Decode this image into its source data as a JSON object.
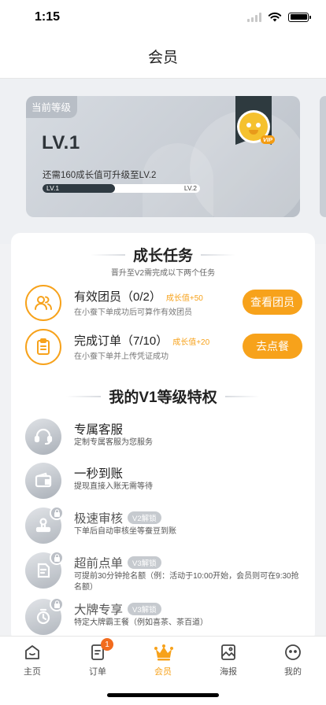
{
  "status_bar": {
    "time": "1:15"
  },
  "header": {
    "title": "会员"
  },
  "level_card": {
    "tag": "当前等级",
    "level": "LV.1",
    "need_text": "还需160成长值可升级至LV.2",
    "progress_fraction": 0.46,
    "bar_left_label": "LV.1",
    "bar_right_label": "LV.2",
    "badge_text": "VIP"
  },
  "growth_tasks": {
    "title": "成长任务",
    "subtitle": "晋升至V2需完成以下两个任务",
    "items": [
      {
        "icon": "team-member-icon",
        "name": "有效团员（0/2）",
        "reward": "成长值+50",
        "desc": "在小蚕下单成功后可算作有效团员",
        "button": "查看团员"
      },
      {
        "icon": "order-clipboard-icon",
        "name": "完成订单（7/10）",
        "reward": "成长值+20",
        "desc": "在小蚕下单并上传凭证成功",
        "button": "去点餐"
      }
    ]
  },
  "privileges": {
    "title": "我的V1等级特权",
    "items": [
      {
        "icon": "headset-service-icon",
        "name": "专属客服",
        "desc": "定制专属客服为您服务",
        "lock": ""
      },
      {
        "icon": "wallet-icon",
        "name": "一秒到账",
        "desc": "提现直接入账无需等待",
        "lock": ""
      },
      {
        "icon": "review-stamp-icon",
        "name": "极速审核",
        "desc": "下单后自动审核坐等蚕豆到账",
        "lock": "V2解锁"
      },
      {
        "icon": "early-order-icon",
        "name": "超前点单",
        "desc": "可提前30分钟抢名额（例：活动于10:00开始，会员则可在9:30抢名额）",
        "lock": "V3解锁"
      },
      {
        "icon": "brand-timer-icon",
        "name": "大牌专享",
        "desc": "特定大牌霸王餐（例如喜茶、茶百道）",
        "lock": "V3解锁"
      }
    ]
  },
  "tab_bar": {
    "tabs": [
      {
        "label": "主页",
        "icon": "home-icon"
      },
      {
        "label": "订单",
        "icon": "order-icon",
        "badge": "1"
      },
      {
        "label": "会员",
        "icon": "crown-icon",
        "active": true
      },
      {
        "label": "海报",
        "icon": "poster-icon"
      },
      {
        "label": "我的",
        "icon": "profile-icon"
      }
    ]
  },
  "colors": {
    "accent": "#f7a21b",
    "badge": "#f26b1d",
    "card_dark": "#2f3a42"
  }
}
